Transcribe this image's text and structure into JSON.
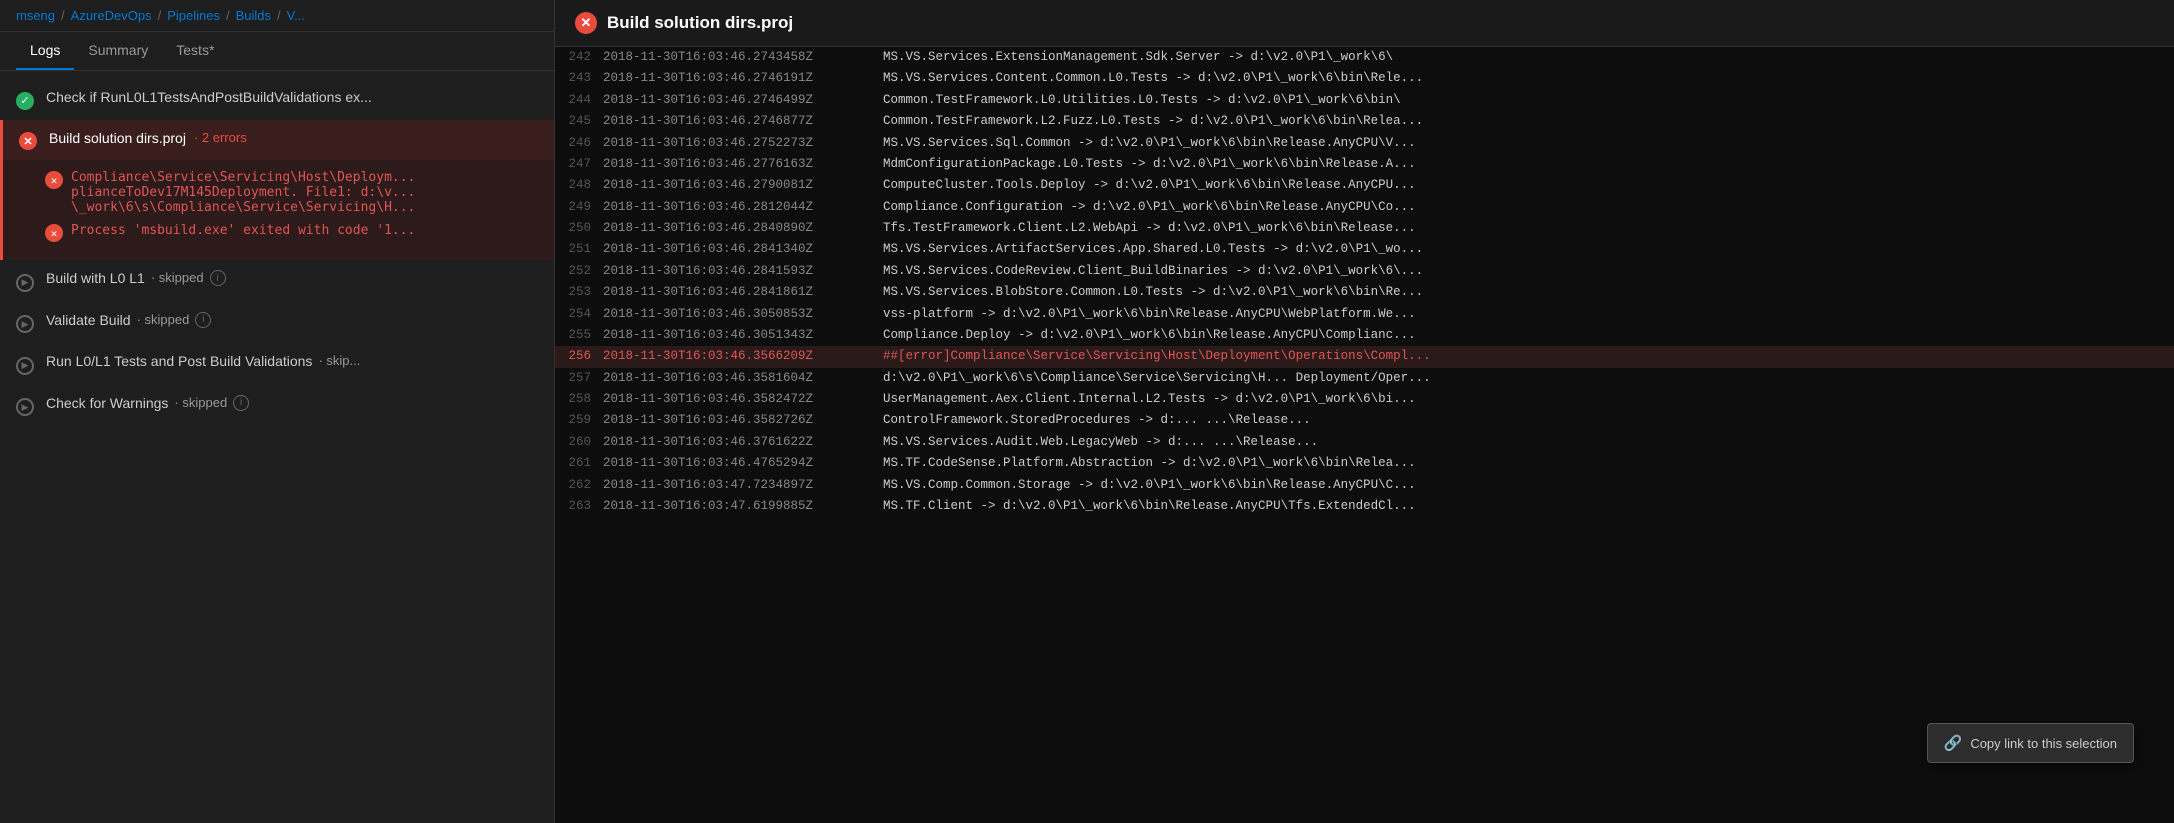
{
  "breadcrumb": {
    "items": [
      "mseng",
      "AzureDevOps",
      "Pipelines",
      "Builds",
      "V..."
    ]
  },
  "tabs": {
    "items": [
      "Logs",
      "Summary",
      "Tests*"
    ],
    "active": "Logs"
  },
  "steps": [
    {
      "id": "check-run",
      "icon": "check-circle",
      "label": "Check if RunL0L1TestsAndPostBuildValidations ex...",
      "status": "",
      "skipped": false,
      "error": false
    },
    {
      "id": "build-solution",
      "icon": "error",
      "label": "Build solution dirs.proj",
      "status": "2 errors",
      "skipped": false,
      "error": true
    },
    {
      "id": "build-l0l1",
      "icon": "play",
      "label": "Build with L0 L1",
      "status": "skipped",
      "skipped": true,
      "error": false,
      "info": true
    },
    {
      "id": "validate-build",
      "icon": "play",
      "label": "Validate Build",
      "status": "skipped",
      "skipped": true,
      "error": false,
      "info": true
    },
    {
      "id": "run-tests",
      "icon": "play",
      "label": "Run L0/L1 Tests and Post Build Validations",
      "status": "skip...",
      "skipped": true,
      "error": false,
      "info": false
    },
    {
      "id": "check-warnings",
      "icon": "play",
      "label": "Check for Warnings",
      "status": "skipped",
      "skipped": true,
      "error": false,
      "info": true
    }
  ],
  "error_messages": [
    {
      "text": "Compliance\\Service\\Servicing\\Host\\Deploym... plianceToDev17M145Deployment. File1: d:\\v...\\_work\\6\\s\\Compliance\\Service\\Servicing\\H..."
    },
    {
      "text": "Process 'msbuild.exe' exited with code '1..."
    }
  ],
  "right_header": {
    "title": "Build solution dirs.proj",
    "icon": "error-circle"
  },
  "log_rows": [
    {
      "line": "242",
      "timestamp": "2018-11-30T16:03:46.2743458Z",
      "text": "MS.VS.Services.ExtensionManagement.Sdk.Server -> d:\\v2.0\\P1\\_work\\6\\",
      "error": false
    },
    {
      "line": "243",
      "timestamp": "2018-11-30T16:03:46.2746191Z",
      "text": "MS.VS.Services.Content.Common.L0.Tests -> d:\\v2.0\\P1\\_work\\6\\bin\\Rele...",
      "error": false
    },
    {
      "line": "244",
      "timestamp": "2018-11-30T16:03:46.2746499Z",
      "text": "Common.TestFramework.L0.Utilities.L0.Tests -> d:\\v2.0\\P1\\_work\\6\\bin\\",
      "error": false
    },
    {
      "line": "245",
      "timestamp": "2018-11-30T16:03:46.2746877Z",
      "text": "Common.TestFramework.L2.Fuzz.L0.Tests -> d:\\v2.0\\P1\\_work\\6\\bin\\Relea...",
      "error": false
    },
    {
      "line": "246",
      "timestamp": "2018-11-30T16:03:46.2752273Z",
      "text": "MS.VS.Services.Sql.Common -> d:\\v2.0\\P1\\_work\\6\\bin\\Release.AnyCPU\\V...",
      "error": false
    },
    {
      "line": "247",
      "timestamp": "2018-11-30T16:03:46.2776163Z",
      "text": "MdmConfigurationPackage.L0.Tests -> d:\\v2.0\\P1\\_work\\6\\bin\\Release.A...",
      "error": false
    },
    {
      "line": "248",
      "timestamp": "2018-11-30T16:03:46.2790081Z",
      "text": "ComputeCluster.Tools.Deploy -> d:\\v2.0\\P1\\_work\\6\\bin\\Release.AnyCPU...",
      "error": false
    },
    {
      "line": "249",
      "timestamp": "2018-11-30T16:03:46.2812044Z",
      "text": "Compliance.Configuration -> d:\\v2.0\\P1\\_work\\6\\bin\\Release.AnyCPU\\Co...",
      "error": false
    },
    {
      "line": "250",
      "timestamp": "2018-11-30T16:03:46.2840890Z",
      "text": "Tfs.TestFramework.Client.L2.WebApi -> d:\\v2.0\\P1\\_work\\6\\bin\\Release...",
      "error": false
    },
    {
      "line": "251",
      "timestamp": "2018-11-30T16:03:46.2841340Z",
      "text": "MS.VS.Services.ArtifactServices.App.Shared.L0.Tests -> d:\\v2.0\\P1\\_wo...",
      "error": false
    },
    {
      "line": "252",
      "timestamp": "2018-11-30T16:03:46.2841593Z",
      "text": "MS.VS.Services.CodeReview.Client_BuildBinaries -> d:\\v2.0\\P1\\_work\\6\\...",
      "error": false
    },
    {
      "line": "253",
      "timestamp": "2018-11-30T16:03:46.2841861Z",
      "text": "MS.VS.Services.BlobStore.Common.L0.Tests -> d:\\v2.0\\P1\\_work\\6\\bin\\Re...",
      "error": false
    },
    {
      "line": "254",
      "timestamp": "2018-11-30T16:03:46.3050853Z",
      "text": "vss-platform -> d:\\v2.0\\P1\\_work\\6\\bin\\Release.AnyCPU\\WebPlatform.We...",
      "error": false
    },
    {
      "line": "255",
      "timestamp": "2018-11-30T16:03:46.3051343Z",
      "text": "Compliance.Deploy -> d:\\v2.0\\P1\\_work\\6\\bin\\Release.AnyCPU\\Complianc...",
      "error": false
    },
    {
      "line": "256",
      "timestamp": "2018-11-30T16:03:46.3566209Z",
      "text": "##[error]Compliance\\Service\\Servicing\\Host\\Deployment\\Operations\\Compl...",
      "error": true
    },
    {
      "line": "257",
      "timestamp": "2018-11-30T16:03:46.3581604Z",
      "text": "d:\\v2.0\\P1\\_work\\6\\s\\Compliance\\Service\\Servicing\\H... Deployment/Oper...",
      "error": false
    },
    {
      "line": "258",
      "timestamp": "2018-11-30T16:03:46.3582472Z",
      "text": "UserManagement.Aex.Client.Internal.L2.Tests -> d:\\v2.0\\P1\\_work\\6\\bi...",
      "error": false
    },
    {
      "line": "259",
      "timestamp": "2018-11-30T16:03:46.3582726Z",
      "text": "ControlFramework.StoredProcedures -> d:... ...\\Release...",
      "error": false
    },
    {
      "line": "260",
      "timestamp": "2018-11-30T16:03:46.3761622Z",
      "text": "MS.VS.Services.Audit.Web.LegacyWeb -> d:... ...\\Release...",
      "error": false
    },
    {
      "line": "261",
      "timestamp": "2018-11-30T16:03:46.4765294Z",
      "text": "MS.TF.CodeSense.Platform.Abstraction -> d:\\v2.0\\P1\\_work\\6\\bin\\Relea...",
      "error": false
    },
    {
      "line": "262",
      "timestamp": "2018-11-30T16:03:47.7234897Z",
      "text": "MS.VS.Comp.Common.Storage -> d:\\v2.0\\P1\\_work\\6\\bin\\Release.AnyCPU\\C...",
      "error": false
    },
    {
      "line": "263",
      "timestamp": "2018-11-30T16:03:47.6199885Z",
      "text": "MS.TF.Client -> d:\\v2.0\\P1\\_work\\6\\bin\\Release.AnyCPU\\Tfs.ExtendedCl...",
      "error": false
    }
  ],
  "tooltip": {
    "label": "Copy link to this selection",
    "icon": "link-icon"
  }
}
